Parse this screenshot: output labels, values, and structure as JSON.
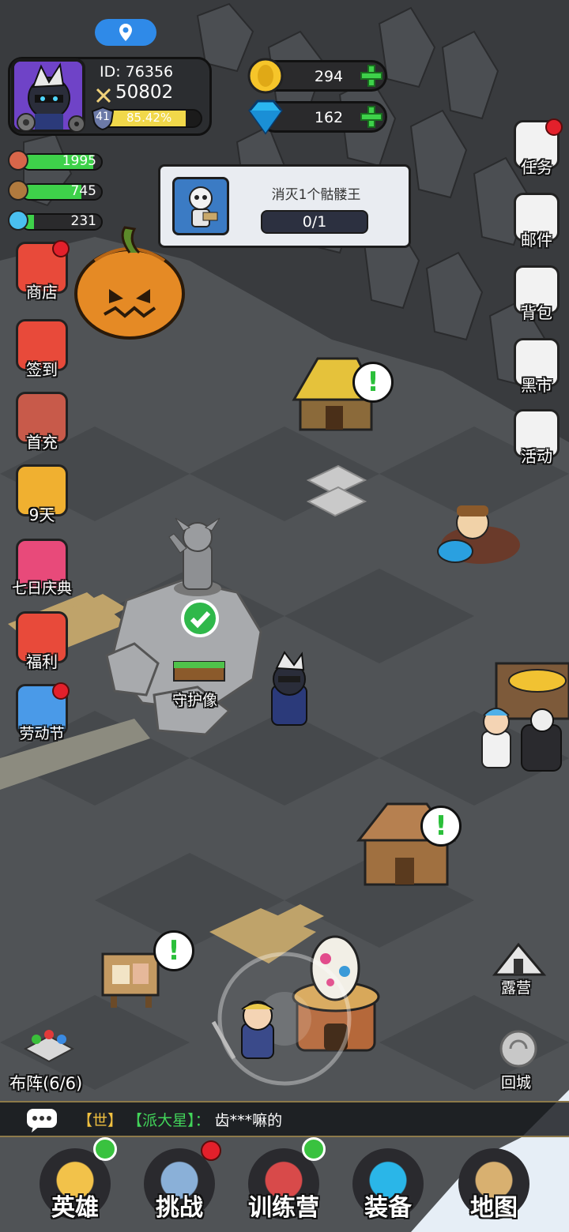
{
  "player": {
    "id_text": "ID: 76356",
    "power": "50802",
    "level": "41",
    "xp_percent_text": "85.42%",
    "xp_fraction": 0.8542
  },
  "currency": {
    "gold": "294",
    "gems": "162"
  },
  "resources": [
    {
      "icon": "meat-icon",
      "value": "1995",
      "fill": 0.9
    },
    {
      "icon": "wood-icon",
      "value": "745",
      "fill": 0.75
    },
    {
      "icon": "crystal-icon",
      "value": "231",
      "fill": 0.15
    }
  ],
  "quest": {
    "title": "消灭1个骷髅王",
    "progress": "0/1"
  },
  "left_menu": [
    {
      "key": "shop",
      "label": "商店",
      "badge": true,
      "icon": "shop-icon"
    },
    {
      "key": "signin",
      "label": "签到",
      "badge": false,
      "icon": "gift-icon"
    },
    {
      "key": "first_recharge",
      "label": "首充",
      "badge": false,
      "icon": "archer-icon"
    },
    {
      "key": "pass",
      "label": "9天",
      "badge": false,
      "icon": "pass-icon"
    },
    {
      "key": "seven_day",
      "label": "七日庆典",
      "badge": false,
      "icon": "gift-box-icon"
    },
    {
      "key": "welfare",
      "label": "福利",
      "badge": false,
      "icon": "welfare-gift-icon"
    },
    {
      "key": "labor_day",
      "label": "劳动节",
      "badge": true,
      "icon": "hammer-coin-icon"
    }
  ],
  "right_menu": [
    {
      "key": "tasks",
      "label": "任务",
      "badge": true,
      "icon": "task-icon"
    },
    {
      "key": "mail",
      "label": "邮件",
      "badge": false,
      "icon": "mail-icon"
    },
    {
      "key": "bag",
      "label": "背包",
      "badge": false,
      "icon": "backpack-icon"
    },
    {
      "key": "black_market",
      "label": "黑市",
      "badge": false,
      "icon": "money-bag-icon"
    },
    {
      "key": "events",
      "label": "活动",
      "badge": false,
      "icon": "card-icon"
    }
  ],
  "world": {
    "statue_label": "守护像",
    "camp_label": "露营",
    "return_label": "回城",
    "formation_label": "布阵(6/6)"
  },
  "chat": {
    "channel": "【世】",
    "sender": "【派大星】：",
    "message": "齿***嘛的"
  },
  "bottom_nav": [
    {
      "key": "heroes",
      "label": "英雄",
      "badge": "up",
      "icon": "heroes-icon"
    },
    {
      "key": "challenge",
      "label": "挑战",
      "badge": "dot",
      "icon": "sword-icon"
    },
    {
      "key": "training",
      "label": "训练营",
      "badge": "up",
      "icon": "target-icon"
    },
    {
      "key": "equipment",
      "label": "装备",
      "badge": "none",
      "icon": "armor-icon"
    },
    {
      "key": "map",
      "label": "地图",
      "badge": "none",
      "icon": "map-icon"
    }
  ],
  "colors": {
    "accent_blue": "#2f8ae8",
    "hp_green": "#3ed14a",
    "xp_yellow": "#f1d84a",
    "badge_red": "#e3202b"
  }
}
